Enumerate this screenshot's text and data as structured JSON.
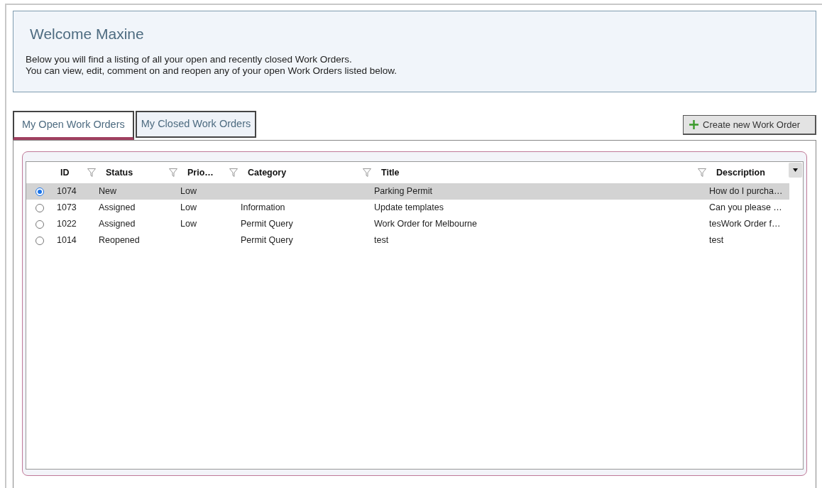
{
  "welcome": {
    "title": "Welcome Maxine",
    "lines": [
      "Below you will find a listing of all your open and recently closed Work Orders.",
      "You can view, edit, comment on and reopen any of your open Work Orders listed below."
    ]
  },
  "tabs": [
    {
      "label": "My Open Work Orders",
      "selected": true
    },
    {
      "label": "My Closed Work Orders",
      "selected": false
    }
  ],
  "create_button": {
    "label": "Create new Work Order"
  },
  "table": {
    "columns": [
      {
        "label": "ID",
        "filter": false
      },
      {
        "label": "Status",
        "filter": true
      },
      {
        "label": "Prio…",
        "filter": true
      },
      {
        "label": "Category",
        "filter": true
      },
      {
        "label": "Title",
        "filter": true
      },
      {
        "label": "Description",
        "filter": true
      }
    ],
    "rows": [
      {
        "selected": true,
        "cells": [
          "1074",
          "New",
          "Low",
          "",
          "Parking Permit",
          "How do I purcha…"
        ]
      },
      {
        "selected": false,
        "cells": [
          "1073",
          "Assigned",
          "Low",
          "Information",
          "Update templates",
          "Can you please …"
        ]
      },
      {
        "selected": false,
        "cells": [
          "1022",
          "Assigned",
          "Low",
          "Permit Query",
          "Work Order for Melbourne",
          "tesWork Order f…"
        ]
      },
      {
        "selected": false,
        "cells": [
          "1014",
          "Reopened",
          "",
          "Permit Query",
          "test",
          "test"
        ]
      }
    ]
  }
}
